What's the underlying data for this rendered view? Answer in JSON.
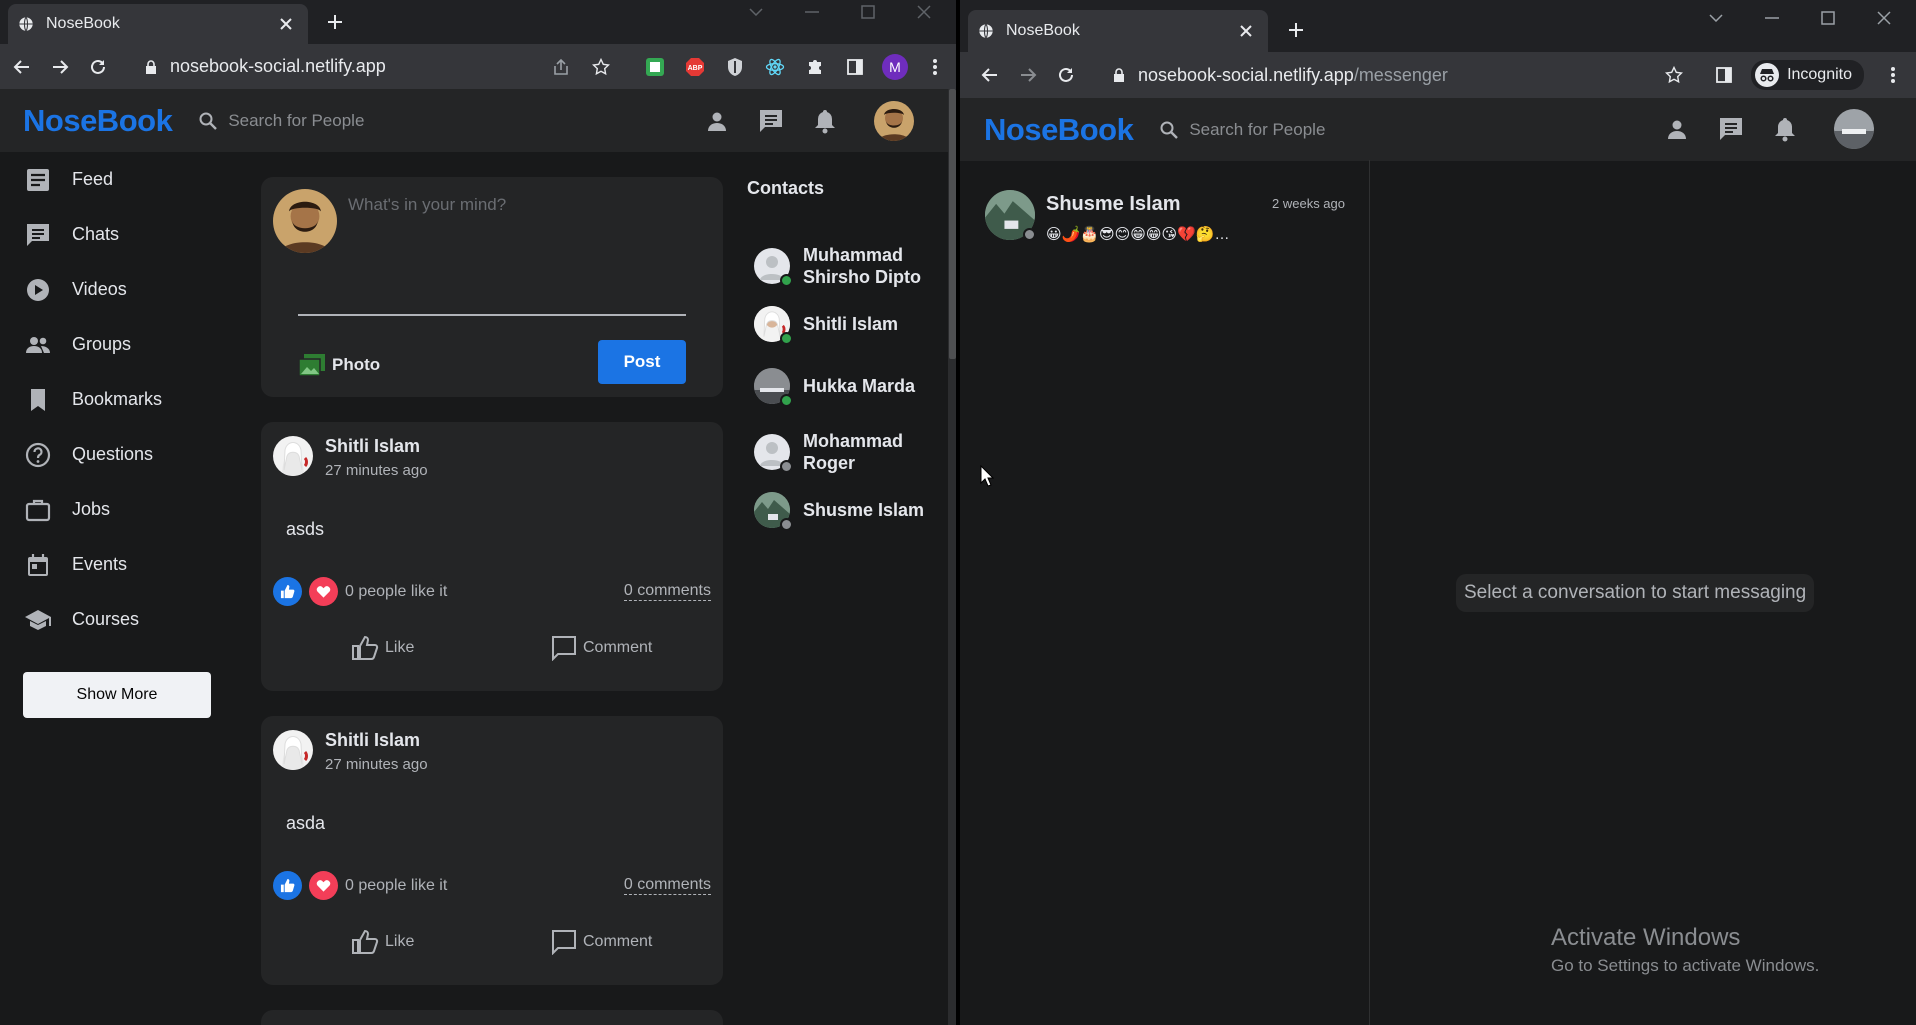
{
  "left_browser": {
    "tab_title": "NoseBook",
    "url_host": "nosebook-social.netlify.app",
    "url_path": "",
    "profile_initial": "M"
  },
  "right_browser": {
    "tab_title": "NoseBook",
    "url_host": "nosebook-social.netlify.app",
    "url_path": "/messenger",
    "incognito_label": "Incognito"
  },
  "app": {
    "logo": "NoseBook",
    "search_placeholder": "Search for People"
  },
  "sidebar": {
    "items": [
      {
        "label": "Feed",
        "icon": "feed-icon"
      },
      {
        "label": "Chats",
        "icon": "chat-icon"
      },
      {
        "label": "Videos",
        "icon": "play-icon"
      },
      {
        "label": "Groups",
        "icon": "groups-icon"
      },
      {
        "label": "Bookmarks",
        "icon": "bookmark-icon"
      },
      {
        "label": "Questions",
        "icon": "question-icon"
      },
      {
        "label": "Jobs",
        "icon": "briefcase-icon"
      },
      {
        "label": "Events",
        "icon": "calendar-icon"
      },
      {
        "label": "Courses",
        "icon": "school-icon"
      }
    ],
    "show_more": "Show More"
  },
  "share": {
    "placeholder": "What's in your mind?",
    "photo_label": "Photo",
    "post_label": "Post"
  },
  "posts": [
    {
      "author": "Shitli Islam",
      "time": "27 minutes ago",
      "text": "asds",
      "likes": "0 people like it",
      "comments": "0 comments",
      "like_label": "Like",
      "comment_label": "Comment"
    },
    {
      "author": "Shitli Islam",
      "time": "27 minutes ago",
      "text": "asda",
      "likes": "0 people like it",
      "comments": "0 comments",
      "like_label": "Like",
      "comment_label": "Comment"
    }
  ],
  "contacts": {
    "title": "Contacts",
    "items": [
      {
        "name": "Muhammad Shirsho Dipto",
        "online": true
      },
      {
        "name": "Shitli Islam",
        "online": true
      },
      {
        "name": "Hukka Marda",
        "online": true
      },
      {
        "name": "Mohammad Roger",
        "online": false
      },
      {
        "name": "Shusme Islam",
        "online": false
      }
    ]
  },
  "messenger": {
    "conversation": {
      "name": "Shusme Islam",
      "time": "2 weeks ago",
      "preview": "😀🌶️🎂😎😊😁😁😘💔🤔…"
    },
    "empty_state": "Select a conversation to start messaging"
  },
  "watermark": {
    "line1": "Activate Windows",
    "line2": "Go to Settings to activate Windows."
  },
  "colors": {
    "brand": "#1b74e4",
    "online": "#31a24c",
    "offline": "#8a8d91",
    "like_blue": "#1b74e4",
    "heart_red": "#f33e58",
    "bg": "#18191a",
    "card": "#242526"
  }
}
